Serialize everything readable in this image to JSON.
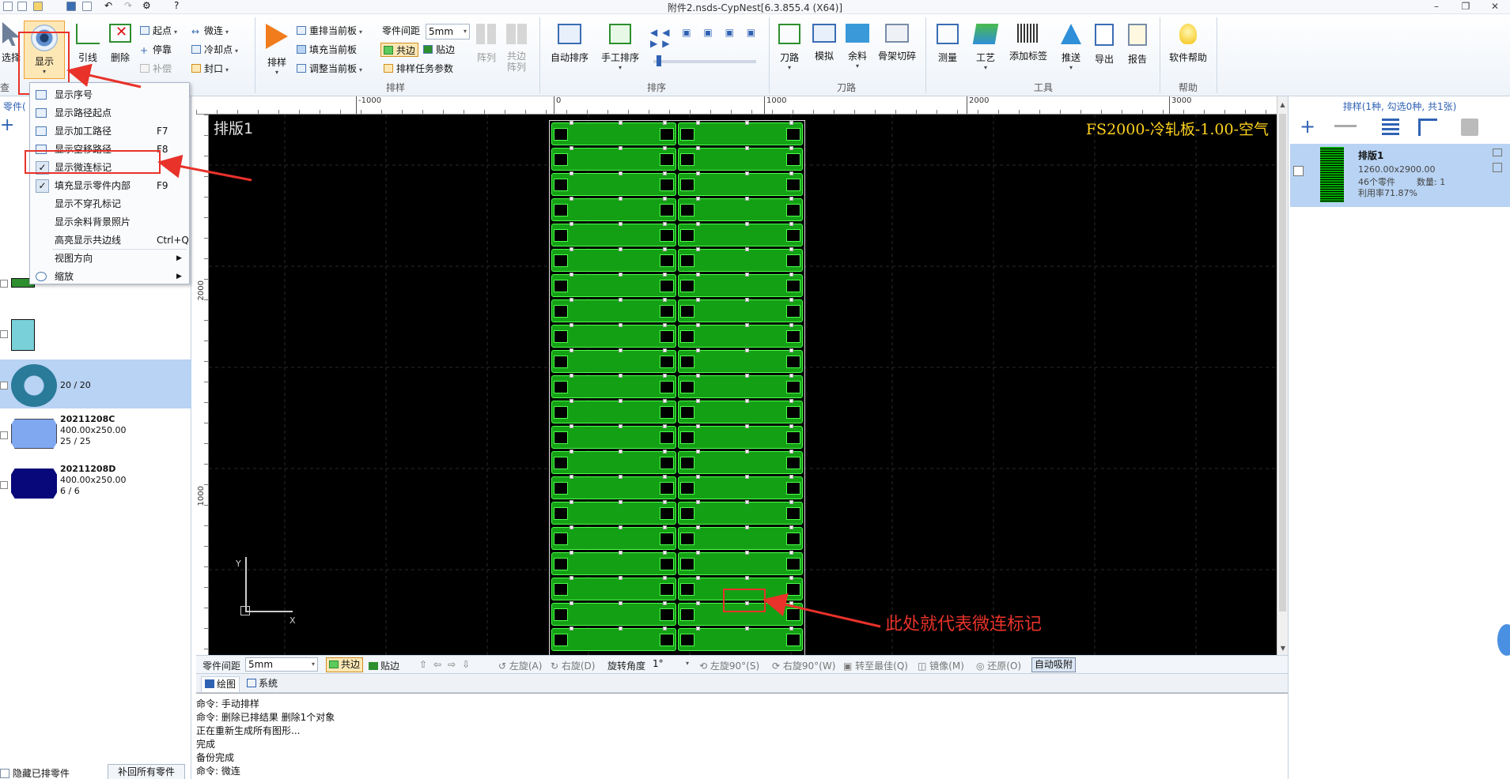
{
  "titlebar": {
    "title": "附件2.nsds-CypNest[6.3.855.4 (X64)]"
  },
  "ribbon": {
    "view_group": {
      "select": "选择",
      "display": "显示",
      "label_partial": "查"
    },
    "edit_group": {
      "lead_line": "引线",
      "delete": "删除",
      "start_point": "起点",
      "micro_joint": "微连",
      "stop": "停靠",
      "cooling_point": "冷却点",
      "compensate": "补偿",
      "seal": "封口"
    },
    "nest_group": {
      "label": "排样",
      "nest": "排样",
      "rearrange": "重排当前板",
      "fill": "填充当前板",
      "adjust": "调整当前板",
      "part_gap_label": "零件间距",
      "part_gap_value": "5mm",
      "common_edge": "共边",
      "edge_snap": "贴边",
      "nest_task_params": "排样任务参数",
      "array": "阵列",
      "common_array": "共边阵列"
    },
    "sort_group": {
      "label": "排序",
      "auto_sort": "自动排序",
      "manual_sort": "手工排序"
    },
    "toolpath_group": {
      "label": "刀路",
      "toolpath": "刀路",
      "simulate": "模拟",
      "remnant": "余料",
      "frame_cut": "骨架切碎"
    },
    "tools_group": {
      "label": "工具",
      "measure": "测量",
      "process": "工艺",
      "add_tag": "添加标签",
      "push": "推送",
      "export": "导出",
      "report": "报告"
    },
    "help_group": {
      "label": "帮助",
      "software_help": "软件帮助"
    }
  },
  "left_panel": {
    "header": "零件(",
    "parts": [
      {
        "count": "20 / 20"
      },
      {
        "name": "20211208C",
        "dims": "400.00x250.00",
        "count": "25 / 25"
      },
      {
        "name": "20211208D",
        "dims": "400.00x250.00",
        "count": "6 / 6"
      }
    ],
    "bottom_checkbox": "隐藏已排零件",
    "bottom_button": "补回所有零件"
  },
  "menu": {
    "items": [
      {
        "label": "显示序号",
        "shortcut": "",
        "checked": false
      },
      {
        "label": "显示路径起点",
        "shortcut": "",
        "checked": false
      },
      {
        "label": "显示加工路径",
        "shortcut": "F7",
        "checked": false
      },
      {
        "label": "显示空移路径",
        "shortcut": "F8",
        "checked": false
      },
      {
        "label": "显示微连标记",
        "shortcut": "",
        "checked": true
      },
      {
        "label": "填充显示零件内部",
        "shortcut": "F9",
        "checked": true
      },
      {
        "label": "显示不穿孔标记",
        "shortcut": "",
        "checked": false
      },
      {
        "label": "显示余料背景照片",
        "shortcut": "",
        "checked": false
      },
      {
        "label": "高亮显示共边线",
        "shortcut": "Ctrl+Q",
        "checked": false
      },
      {
        "label": "视图方向",
        "shortcut": "",
        "checked": false,
        "submenu": true
      },
      {
        "label": "缩放",
        "shortcut": "",
        "checked": false,
        "submenu": true
      }
    ]
  },
  "canvas": {
    "sheet_label": "排版1",
    "material_label": "FS2000-冷轧板-1.00-空气",
    "annotation": "此处就代表微连标记",
    "ruler_top": [
      "-1000",
      "0",
      "1000",
      "2000",
      "3000"
    ],
    "ruler_left": [
      "2000",
      "1000"
    ],
    "axis_x": "X",
    "axis_y": "Y",
    "rows": 21
  },
  "right_panel": {
    "header": "排样(1种, 勾选0种, 共1张)",
    "sheet": {
      "name": "排版1",
      "dims": "1260.00x2900.00",
      "parts": "46个零件",
      "qty": "数量: 1",
      "usage": "利用率71.87%"
    }
  },
  "bottom_toolbar": {
    "part_gap_label": "零件间距",
    "part_gap_value": "5mm",
    "common_edge": "共边",
    "edge_snap": "贴边",
    "rotate_left": "左旋(A)",
    "rotate_right": "右旋(D)",
    "rotate_angle_label": "旋转角度",
    "rotate_angle_value": "1°",
    "rotate_left_90": "左旋90°(S)",
    "rotate_right_90": "右旋90°(W)",
    "rotate_best": "转至最佳(Q)",
    "mirror": "镜像(M)",
    "restore": "还原(O)",
    "auto_attach": "自动吸附"
  },
  "tabs": {
    "drawing": "绘图",
    "system": "系统"
  },
  "command_log": [
    "命令: 手动排样",
    "命令: 删除已排结果    删除1个对象",
    "正在重新生成所有图形...",
    "完成",
    "备份完成",
    "命令: 微连"
  ],
  "colors": {
    "part_green": "#14a014",
    "outline_green": "#4cff4c",
    "annotation_red": "#e8322a",
    "material_yellow": "#ffd21e"
  }
}
